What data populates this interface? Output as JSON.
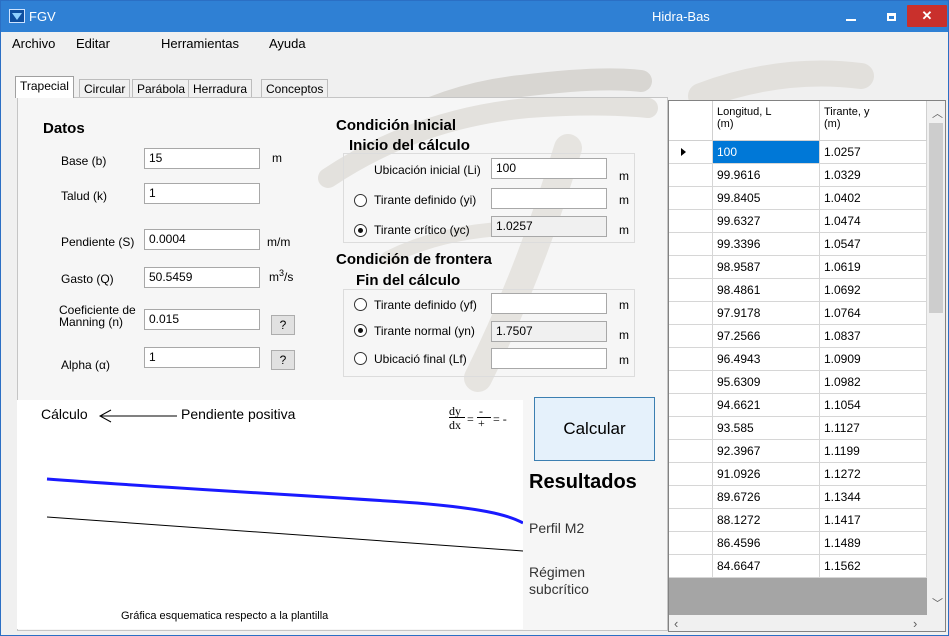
{
  "window": {
    "app_name": "FGV",
    "title": "Hidra-Bas",
    "close_glyph": "✕"
  },
  "menu": [
    "Archivo",
    "Editar",
    "Herramientas",
    "Ayuda"
  ],
  "tabs": [
    "Trapecial",
    "Circular",
    "Parábola",
    "Herradura",
    "Conceptos"
  ],
  "datos": {
    "header": "Datos",
    "base_label": "Base (b)",
    "base_value": "15",
    "base_unit": "m",
    "talud_label": "Talud (k)",
    "talud_value": "1",
    "pendiente_label": "Pendiente (S)",
    "pendiente_value": "0.0004",
    "pendiente_unit": "m/m",
    "gasto_label": "Gasto (Q)",
    "gasto_value": "50.5459",
    "gasto_unit_base": "m",
    "gasto_unit_sup": "3",
    "gasto_unit_tail": "/s",
    "manning_label_1": "Coeficiente de",
    "manning_label_2": "Manning (n)",
    "manning_value": "0.015",
    "manning_help": "?",
    "alpha_label": "Alpha (α)",
    "alpha_value": "1",
    "alpha_help": "?"
  },
  "inicial": {
    "header": "Condición Inicial",
    "sub": "Inicio del cálculo",
    "ubicacion_label": "Ubicación inicial (Li)",
    "ubicacion_value": "100",
    "ubicacion_unit": "m",
    "tirante_def_label": "Tirante definido (yi)",
    "tirante_def_value": "",
    "tirante_def_unit": "m",
    "tirante_crit_label": "Tirante crítico (yc)",
    "tirante_crit_value": "1.0257",
    "tirante_crit_unit": "m"
  },
  "frontera": {
    "header": "Condición de frontera",
    "sub": "Fin del cálculo",
    "tirante_def_label": "Tirante definido (yf)",
    "tirante_def_value": "",
    "tirante_def_unit": "m",
    "tirante_normal_label": "Tirante normal (yn)",
    "tirante_normal_value": "1.7507",
    "tirante_normal_unit": "m",
    "ubicacion_final_label": "Ubicació final (Lf)",
    "ubicacion_final_value": "",
    "ubicacion_final_unit": "m"
  },
  "graph": {
    "calculo_label": "Cálculo",
    "pendiente_label": "Pendiente positiva",
    "formula_num": "dy",
    "formula_den": "dx",
    "formula_rhs_num": "-",
    "formula_rhs_den": "+",
    "formula_tail": "= -",
    "caption": "Gráfica esquematica respecto a la plantilla",
    "profile_color": "#1a1aff"
  },
  "calcular": "Calcular",
  "resultados": {
    "title": "Resultados",
    "perfil": "Perfil  M2",
    "regimen_1": "Régimen",
    "regimen_2": "subcrítico"
  },
  "table": {
    "col1_line1": "Longitud, L",
    "col1_line2": "(m)",
    "col2_line1": "Tirante, y",
    "col2_line2": "(m)",
    "rows": [
      [
        "100",
        "1.0257"
      ],
      [
        "99.9616",
        "1.0329"
      ],
      [
        "99.8405",
        "1.0402"
      ],
      [
        "99.6327",
        "1.0474"
      ],
      [
        "99.3396",
        "1.0547"
      ],
      [
        "98.9587",
        "1.0619"
      ],
      [
        "98.4861",
        "1.0692"
      ],
      [
        "97.9178",
        "1.0764"
      ],
      [
        "97.2566",
        "1.0837"
      ],
      [
        "96.4943",
        "1.0909"
      ],
      [
        "95.6309",
        "1.0982"
      ],
      [
        "94.6621",
        "1.1054"
      ],
      [
        "93.585",
        "1.1127"
      ],
      [
        "92.3967",
        "1.1199"
      ],
      [
        "91.0926",
        "1.1272"
      ],
      [
        "89.6726",
        "1.1344"
      ],
      [
        "88.1272",
        "1.1417"
      ],
      [
        "86.4596",
        "1.1489"
      ],
      [
        "84.6647",
        "1.1562"
      ]
    ]
  },
  "colors": {
    "titlebar": "#2f80d4",
    "selection": "#0078d7",
    "close": "#c9302c"
  }
}
